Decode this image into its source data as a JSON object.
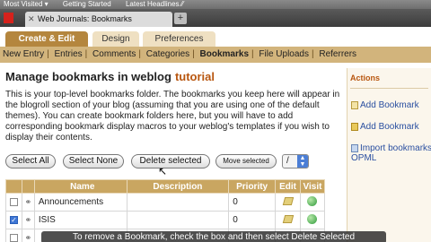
{
  "browser": {
    "bookmarks": [
      "Most Visited ▾",
      "Getting Started",
      "Latest Headlines ⁄⁄"
    ],
    "tab_title": "Web Journals: Bookmarks",
    "tab_close": "✕",
    "new_tab": "+"
  },
  "app_tabs": [
    "Create & Edit",
    "Design",
    "Preferences"
  ],
  "subnav": [
    "New Entry",
    "Entries",
    "Comments",
    "Categories",
    "Bookmarks",
    "File Uploads",
    "Referrers"
  ],
  "page": {
    "title": "Manage bookmarks in weblog",
    "blog_name": "tutorial",
    "description": "This is your top-level bookmarks folder. The bookmarks you keep here will appear in the blogroll section of your blog (assuming that you are using one of the default themes). You can create bookmark folders here, but you will have to add corresponding bookmark display macros to your weblog's templates if you wish to display their contents."
  },
  "buttons": {
    "select_all": "Select All",
    "select_none": "Select None",
    "delete_selected": "Delete selected",
    "move_selected": "Move selected",
    "folder_select": "/"
  },
  "table": {
    "headers": [
      "",
      "",
      "Name",
      "Description",
      "Priority",
      "Edit",
      "Visit"
    ],
    "rows": [
      {
        "name": "Announcements",
        "description": "",
        "priority": "0",
        "checked": false
      },
      {
        "name": "ISIS",
        "description": "",
        "priority": "0",
        "checked": true
      },
      {
        "name": "",
        "description": "",
        "priority": "",
        "checked": false
      }
    ]
  },
  "actions": {
    "title": "Actions",
    "add_bookmark": "Add Bookmark",
    "add_folder": "Add Bookmark",
    "import": "Import bookmarks",
    "import_line2": "OPML"
  },
  "caption": "To remove a Bookmark, check the box and then select Delete Selected",
  "colors": {
    "accent": "#b4863e",
    "subnav": "#d2b47c",
    "blog_name": "#b8560f",
    "link": "#2a4fa0"
  }
}
